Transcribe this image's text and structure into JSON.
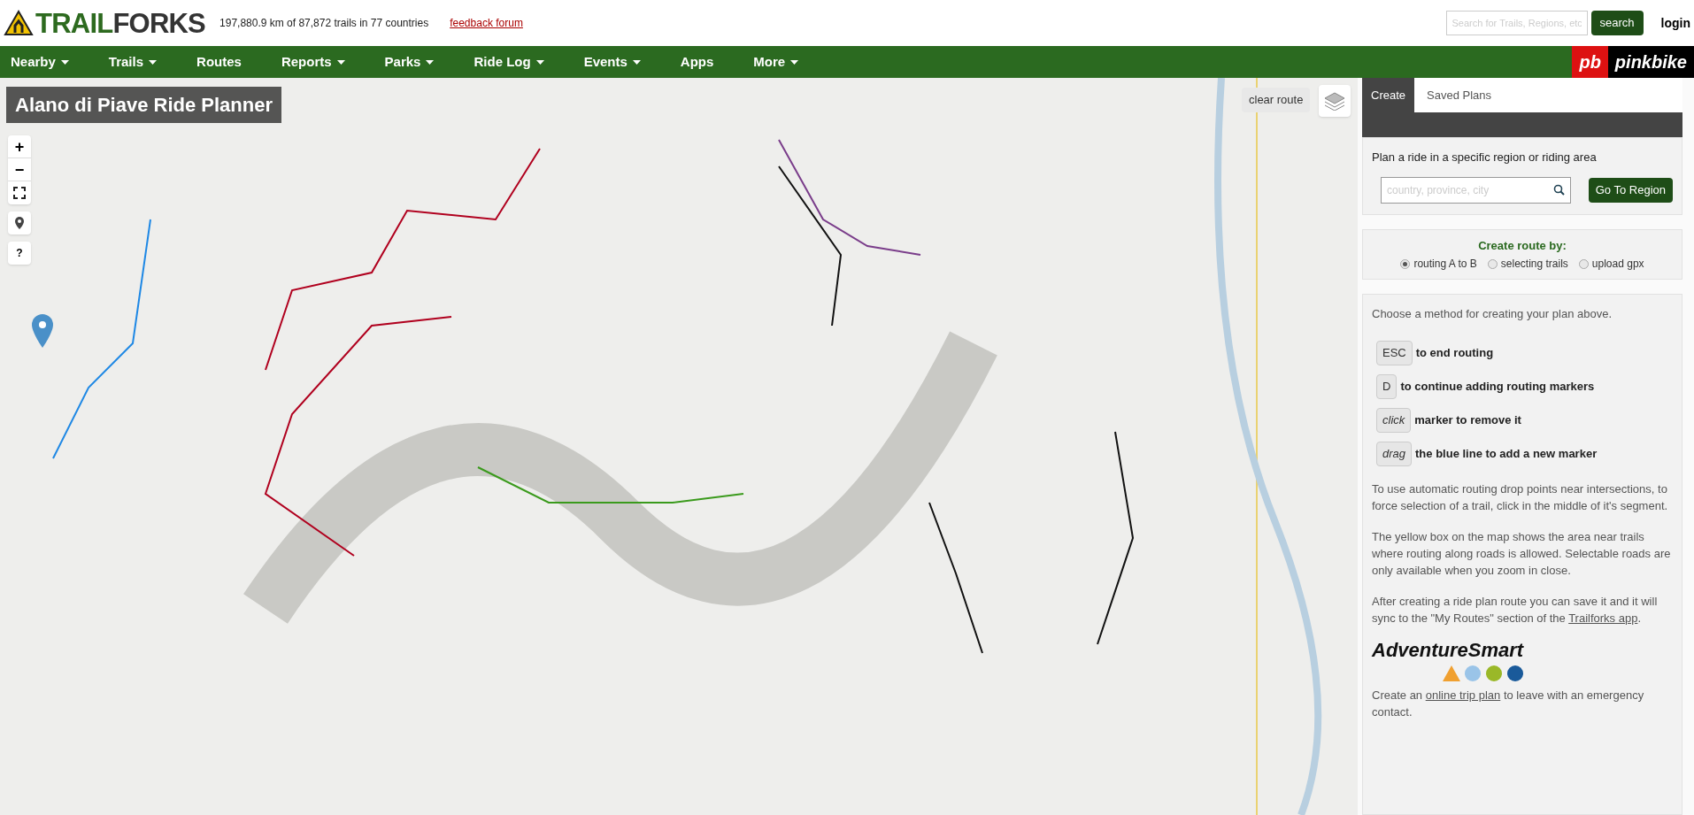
{
  "header": {
    "logo": {
      "part_1": "TRAIL",
      "part_2": "FORKS"
    },
    "stats": "197,880.9 km of 87,872 trails in 77 countries",
    "feedback_link": "feedback forum",
    "search": {
      "placeholder": "Search for Trails, Regions, etc",
      "button": "search"
    },
    "login": "login"
  },
  "nav": {
    "items": [
      {
        "label": "Nearby",
        "dropdown": true
      },
      {
        "label": "Trails",
        "dropdown": true
      },
      {
        "label": "Routes",
        "dropdown": false
      },
      {
        "label": "Reports",
        "dropdown": true
      },
      {
        "label": "Parks",
        "dropdown": true
      },
      {
        "label": "Ride Log",
        "dropdown": true
      },
      {
        "label": "Events",
        "dropdown": true
      },
      {
        "label": "Apps",
        "dropdown": false
      },
      {
        "label": "More",
        "dropdown": true
      }
    ],
    "partner": {
      "badge": "pb",
      "name": "pinkbike"
    }
  },
  "map": {
    "title": "Alano di Piave Ride Planner",
    "clear_button": "clear route",
    "zoom_in": "+",
    "zoom_out": "−",
    "help": "?"
  },
  "panel": {
    "tabs": [
      {
        "label": "Create",
        "selected": true
      },
      {
        "label": "Saved Plans",
        "selected": false
      }
    ],
    "region_prompt": "Plan a ride in a specific region or riding area",
    "region_field": {
      "placeholder": "country, province, city"
    },
    "region_button": "Go To Region",
    "route_by": {
      "title": "Create route by:",
      "options": [
        {
          "label": "routing A to B",
          "selected": true
        },
        {
          "label": "selecting trails",
          "selected": false
        },
        {
          "label": "upload gpx",
          "selected": false
        }
      ]
    },
    "method_hint": "Choose a method for creating your plan above.",
    "keys": [
      {
        "key": "ESC",
        "italic": false,
        "text": "to end routing"
      },
      {
        "key": "D",
        "italic": false,
        "text": "to continue adding routing markers"
      },
      {
        "key": "click",
        "italic": true,
        "text": "marker to remove it"
      },
      {
        "key": "drag",
        "italic": true,
        "text": "the blue line to add a new marker"
      }
    ],
    "paragraphs": [
      "To use automatic routing drop points near intersections, to force selection of a trail, click in the middle of it's segment.",
      "The yellow box on the map shows the area near trails where routing along roads is allowed. Selectable roads are only available when you zoom in close."
    ],
    "sync": {
      "before": "After creating a ride plan route you can save it and it will sync to the \"My Routes\" section of the ",
      "link": "Trailforks app",
      "after": "."
    },
    "adventure_logo": "AdventureSmart",
    "trip": {
      "before": "Create an ",
      "link": "online trip plan",
      "after": " to leave with an emergency contact."
    }
  }
}
